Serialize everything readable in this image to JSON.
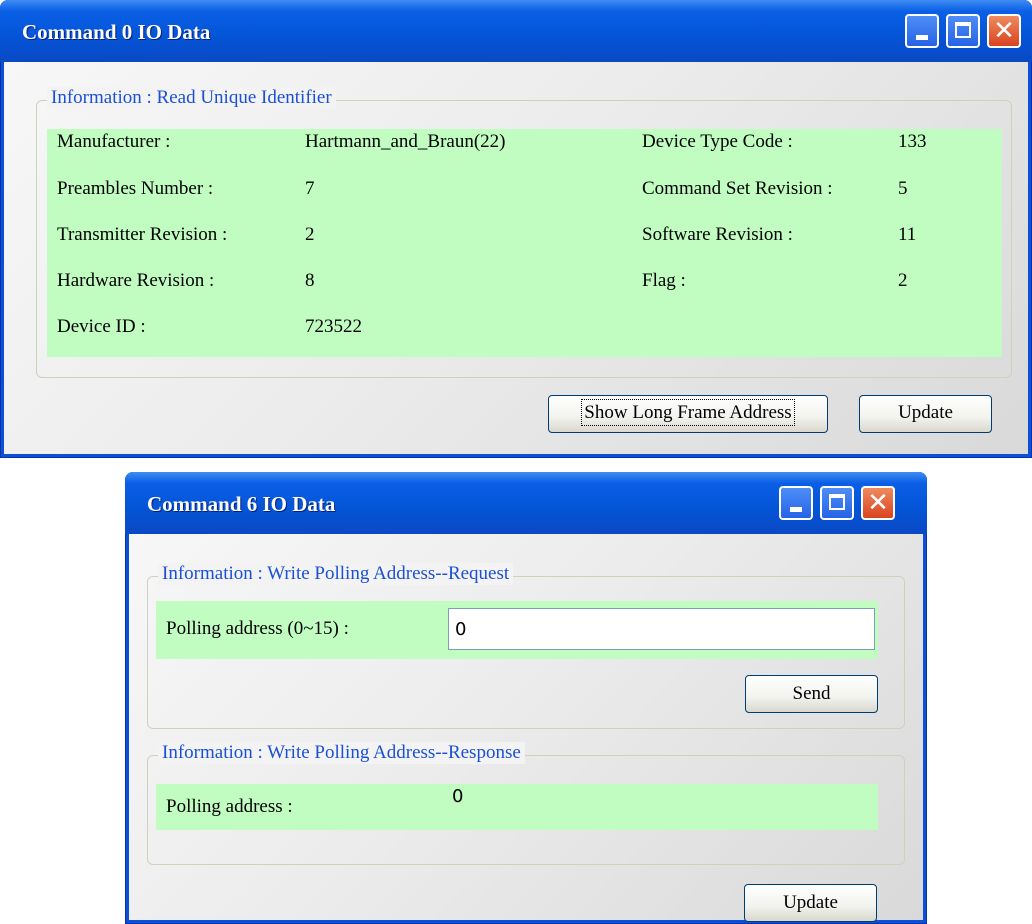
{
  "cmd0": {
    "title": "Command 0 IO Data",
    "group_title": "Information : Read Unique Identifier",
    "fields": {
      "manufacturer_label": "Manufacturer :",
      "manufacturer_value": "Hartmann_and_Braun(22)",
      "device_type_label": "Device Type Code :",
      "device_type_value": "133",
      "preambles_label": "Preambles Number :",
      "preambles_value": "7",
      "cmd_set_label": "Command Set Revision :",
      "cmd_set_value": "5",
      "transmitter_label": "Transmitter Revision :",
      "transmitter_value": "2",
      "software_label": "Software Revision :",
      "software_value": "11",
      "hardware_label": "Hardware Revision :",
      "hardware_value": "8",
      "flag_label": "Flag :",
      "flag_value": "2",
      "device_id_label": "Device ID :",
      "device_id_value": "723522"
    },
    "show_long_frame_label": "Show Long Frame Address",
    "update_label": "Update"
  },
  "cmd6": {
    "title": "Command 6 IO Data",
    "request_group_title": "Information : Write Polling Address--Request",
    "polling_request_label": "Polling address (0~15) :",
    "polling_request_value": "0",
    "send_label": "Send",
    "response_group_title": "Information : Write Polling Address--Response",
    "polling_response_label": "Polling address :",
    "polling_response_value": "0",
    "update_label": "Update"
  },
  "colors": {
    "titlebar": "#0454d6",
    "group_title": "#1a4fd6",
    "field_background": "#c1fcc1",
    "close_button": "#d9441f"
  },
  "icons": [
    "minimize-icon",
    "maximize-icon",
    "close-icon"
  ]
}
